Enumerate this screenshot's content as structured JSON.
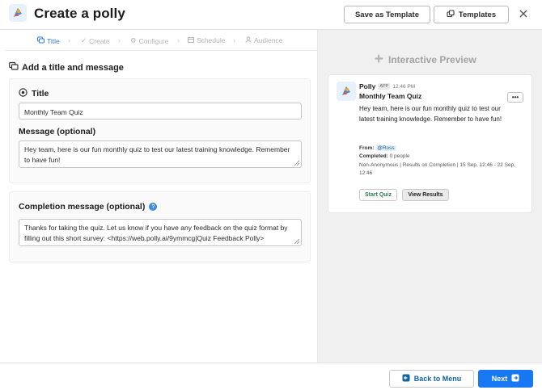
{
  "header": {
    "title": "Create a polly",
    "save_template": "Save as Template",
    "templates": "Templates"
  },
  "steps": [
    {
      "label": "Title",
      "active": true
    },
    {
      "label": "Create",
      "active": false
    },
    {
      "label": "Configure",
      "active": false
    },
    {
      "label": "Schedule",
      "active": false
    },
    {
      "label": "Audience",
      "active": false
    }
  ],
  "form": {
    "section_title": "Add a title and message",
    "title_label": "Title",
    "title_value": "Monthly Team Quiz",
    "message_label": "Message (optional)",
    "message_value": "Hey team, here is our fun monthly quiz to test our latest training knowledge. Remember to have fun!",
    "completion_label": "Completion message (optional)",
    "completion_value": "Thanks for taking the quiz. Let us know if you have any feedback on the quiz format by filling out this short survey: <https://web.polly.ai/9ymmcg|Quiz Feedback Polly>"
  },
  "preview": {
    "title": "Interactive Preview",
    "sender": "Polly",
    "app_tag": "APP",
    "time": "12:46 PM",
    "heading": "Monthly Team Quiz",
    "body": "Hey team, here is our fun monthly quiz to test our latest training knowledge. Remember to have fun!",
    "from_label": "From:",
    "from_value": "@Ross",
    "completed_label": "Completed:",
    "completed_value": "0 people",
    "details": "Non-Anonymous | Results on Completion | 15 Sep, 12:46 - 22 Sep, 12:46",
    "more": "•••",
    "start_quiz": "Start Quiz",
    "view_results": "View Results"
  },
  "footer": {
    "back": "Back to Menu",
    "next": "Next"
  },
  "colors": {
    "accent": "#1877f2",
    "link": "#1264a3",
    "step_active": "#3a7bd5",
    "preview_bg": "#f0f0f0"
  }
}
